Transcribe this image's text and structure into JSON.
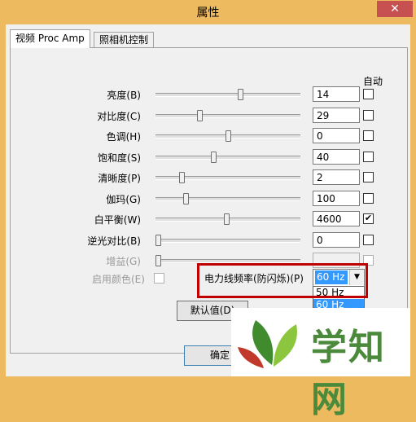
{
  "window": {
    "title": "属性",
    "close_glyph": "✕"
  },
  "tabs": [
    {
      "label": "视频 Proc Amp"
    },
    {
      "label": "照相机控制"
    }
  ],
  "auto_header": "自动",
  "rows": [
    {
      "label": "亮度(B)",
      "value": "14",
      "level": 0.59,
      "auto": false,
      "enabled": true
    },
    {
      "label": "对比度(C)",
      "value": "29",
      "level": 0.3,
      "auto": false,
      "enabled": true
    },
    {
      "label": "色调(H)",
      "value": "0",
      "level": 0.5,
      "auto": false,
      "enabled": true
    },
    {
      "label": "饱和度(S)",
      "value": "40",
      "level": 0.4,
      "auto": false,
      "enabled": true
    },
    {
      "label": "清晰度(P)",
      "value": "2",
      "level": 0.17,
      "auto": false,
      "enabled": true
    },
    {
      "label": "伽玛(G)",
      "value": "100",
      "level": 0.2,
      "auto": false,
      "enabled": true
    },
    {
      "label": "白平衡(W)",
      "value": "4600",
      "level": 0.49,
      "auto": true,
      "enabled": true
    },
    {
      "label": "逆光对比(B)",
      "value": "0",
      "level": 0.0,
      "auto": false,
      "enabled": true
    },
    {
      "label": "增益(G)",
      "value": "",
      "level": 0.0,
      "auto": false,
      "enabled": false
    }
  ],
  "color_enable": {
    "label": "启用颜色(E)",
    "checked": false
  },
  "power_line": {
    "label": "电力线频率(防闪烁)(P)",
    "selected": "60 Hz",
    "options": [
      "50 Hz",
      "60 Hz"
    ]
  },
  "default_button": "默认值(D)",
  "ok_button": "确定",
  "watermark": {
    "text": "学知网"
  }
}
